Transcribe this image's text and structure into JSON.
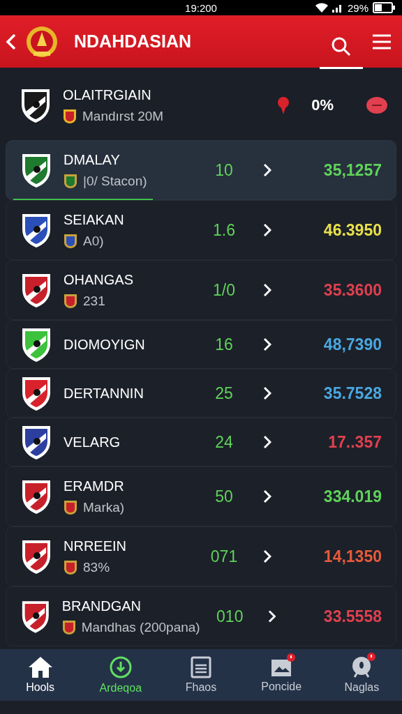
{
  "status_bar": {
    "time": "19:200",
    "battery": "29%"
  },
  "header": {
    "title": "NDAHDASIAN"
  },
  "summary": {
    "name": "OLAITRGIAIN",
    "subtitle": "Mandırst 20M",
    "percent": "0%"
  },
  "rows": [
    {
      "name": "DMALAY",
      "subtitle": "|0/ Stacon)",
      "score": "10",
      "value": {
        "text": "35,1257",
        "color": "#5fd35a"
      },
      "crest": {
        "color": "#1e7a2e"
      },
      "selected": true
    },
    {
      "name": "SEIAKAN",
      "subtitle": "A0)",
      "score": "1.6",
      "value": {
        "text": "46.3950",
        "color": "#e8e04a"
      },
      "crest": {
        "color": "#2b4fb8"
      },
      "selected": false
    },
    {
      "name": "OHANGAS",
      "subtitle": "231",
      "score": "1/0",
      "value": {
        "text": "35.3600",
        "color": "#e0404f"
      },
      "crest": {
        "color": "#c8202a"
      },
      "selected": false
    },
    {
      "name": "DIOMOYIGN",
      "score": "16",
      "value": {
        "text": "48,7390",
        "color": "#4aa8e0"
      },
      "crest": {
        "color": "#3cc23c"
      },
      "selected": false
    },
    {
      "name": "DERTANNIN",
      "score": "25",
      "value": {
        "text": "35.7528",
        "color": "#4aa8e0"
      },
      "crest": {
        "color": "#d8222c"
      },
      "selected": false
    },
    {
      "name": "VELARG",
      "score": "24",
      "value": {
        "text": "17..357",
        "color": "#e0404f"
      },
      "crest": {
        "color": "#2d3f9e"
      },
      "selected": false
    },
    {
      "name": "ERAMDR",
      "subtitle": "Marka)",
      "score": "50",
      "value": {
        "text": "334.019",
        "color": "#5fd35a"
      },
      "crest": {
        "color": "#c8202a"
      },
      "selected": false
    },
    {
      "name": "NRREEIN",
      "subtitle": "83%",
      "score": "071",
      "value": {
        "text": "14,1350",
        "color": "#e85a3a"
      },
      "crest": {
        "color": "#c8202a"
      },
      "selected": false
    },
    {
      "name": "BRANDGAN",
      "subtitle": "Mandhas (200pana)",
      "score": "010",
      "value": {
        "text": "33.5558",
        "color": "#e0404f"
      },
      "crest": {
        "color": "#c8202a"
      },
      "selected": false
    }
  ],
  "nav": [
    {
      "label": "Hools",
      "kind": "home",
      "selected": false,
      "alert": false
    },
    {
      "label": "Ardeqoa",
      "kind": "download",
      "selected": true,
      "alert": false
    },
    {
      "label": "Fhaos",
      "kind": "news",
      "selected": false,
      "alert": false
    },
    {
      "label": "Poncide",
      "kind": "photo",
      "selected": false,
      "alert": true
    },
    {
      "label": "Naglas",
      "kind": "chat",
      "selected": false,
      "alert": true
    }
  ]
}
